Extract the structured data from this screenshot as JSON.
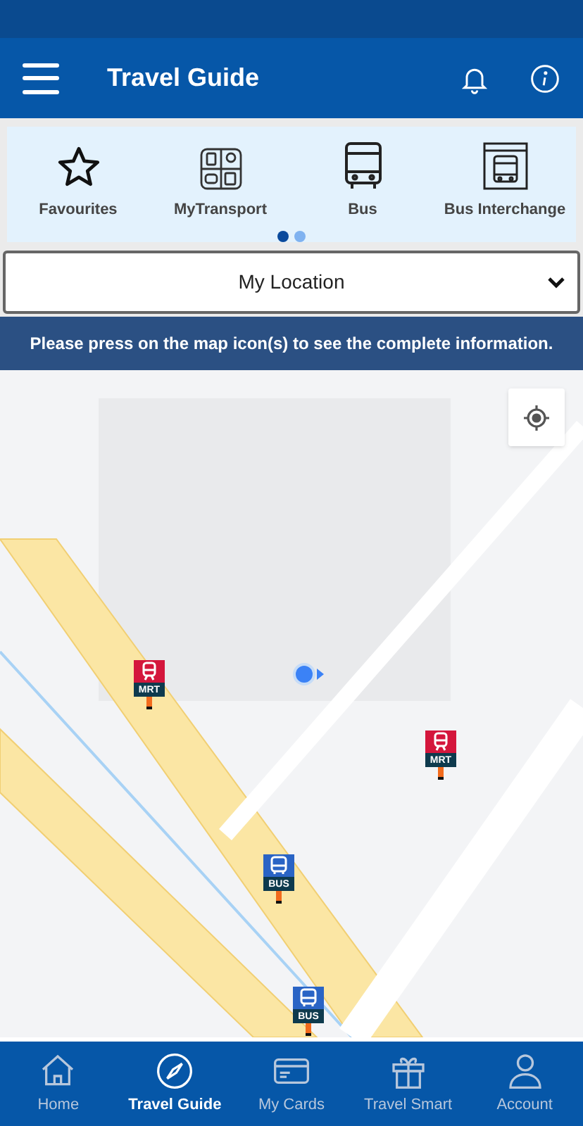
{
  "header": {
    "title": "Travel Guide"
  },
  "shortcuts": [
    {
      "kind": "favourites",
      "label": "Favourites"
    },
    {
      "kind": "mytransport",
      "label": "MyTransport"
    },
    {
      "kind": "bus",
      "label": "Bus"
    },
    {
      "kind": "interchange",
      "label": "Bus Interchange"
    }
  ],
  "pager": [
    {
      "selected": true
    },
    {
      "selected": false
    }
  ],
  "location_select": {
    "value": "My Location"
  },
  "banner": "Please press on the map icon(s) to see the complete information.",
  "map_markers": [
    {
      "kind": "mrt",
      "label": "MRT"
    },
    {
      "kind": "mrt",
      "label": "MRT"
    },
    {
      "kind": "bus",
      "label": "BUS"
    },
    {
      "kind": "bus",
      "label": "BUS"
    }
  ],
  "bottom_nav": [
    {
      "kind": "home",
      "label": "Home",
      "selected": false
    },
    {
      "kind": "compass",
      "label": "Travel Guide",
      "selected": true
    },
    {
      "kind": "card",
      "label": "My Cards",
      "selected": false
    },
    {
      "kind": "gift",
      "label": "Travel Smart",
      "selected": false
    },
    {
      "kind": "person",
      "label": "Account",
      "selected": false
    }
  ]
}
